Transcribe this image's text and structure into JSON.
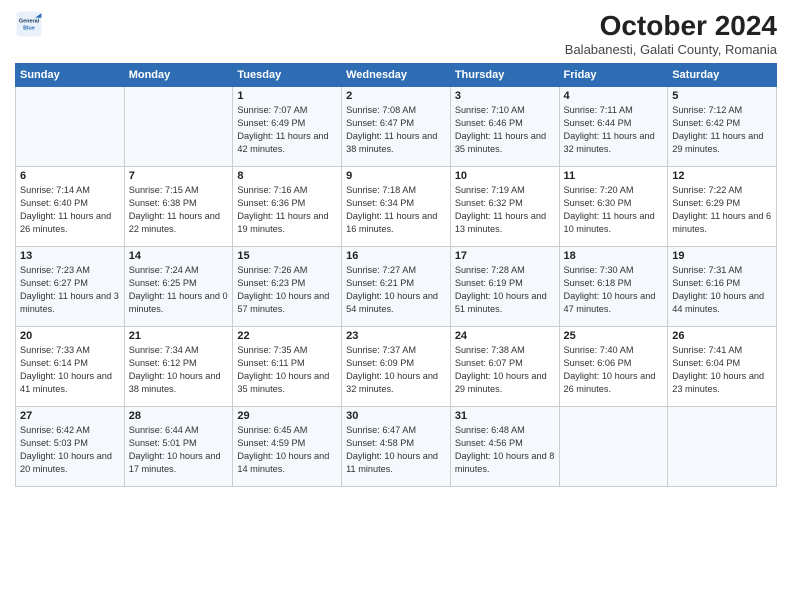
{
  "header": {
    "logo_line1": "General",
    "logo_line2": "Blue",
    "month_title": "October 2024",
    "subtitle": "Balabanesti, Galati County, Romania"
  },
  "days_of_week": [
    "Sunday",
    "Monday",
    "Tuesday",
    "Wednesday",
    "Thursday",
    "Friday",
    "Saturday"
  ],
  "weeks": [
    [
      {
        "day": "",
        "info": ""
      },
      {
        "day": "",
        "info": ""
      },
      {
        "day": "1",
        "info": "Sunrise: 7:07 AM\nSunset: 6:49 PM\nDaylight: 11 hours and 42 minutes."
      },
      {
        "day": "2",
        "info": "Sunrise: 7:08 AM\nSunset: 6:47 PM\nDaylight: 11 hours and 38 minutes."
      },
      {
        "day": "3",
        "info": "Sunrise: 7:10 AM\nSunset: 6:46 PM\nDaylight: 11 hours and 35 minutes."
      },
      {
        "day": "4",
        "info": "Sunrise: 7:11 AM\nSunset: 6:44 PM\nDaylight: 11 hours and 32 minutes."
      },
      {
        "day": "5",
        "info": "Sunrise: 7:12 AM\nSunset: 6:42 PM\nDaylight: 11 hours and 29 minutes."
      }
    ],
    [
      {
        "day": "6",
        "info": "Sunrise: 7:14 AM\nSunset: 6:40 PM\nDaylight: 11 hours and 26 minutes."
      },
      {
        "day": "7",
        "info": "Sunrise: 7:15 AM\nSunset: 6:38 PM\nDaylight: 11 hours and 22 minutes."
      },
      {
        "day": "8",
        "info": "Sunrise: 7:16 AM\nSunset: 6:36 PM\nDaylight: 11 hours and 19 minutes."
      },
      {
        "day": "9",
        "info": "Sunrise: 7:18 AM\nSunset: 6:34 PM\nDaylight: 11 hours and 16 minutes."
      },
      {
        "day": "10",
        "info": "Sunrise: 7:19 AM\nSunset: 6:32 PM\nDaylight: 11 hours and 13 minutes."
      },
      {
        "day": "11",
        "info": "Sunrise: 7:20 AM\nSunset: 6:30 PM\nDaylight: 11 hours and 10 minutes."
      },
      {
        "day": "12",
        "info": "Sunrise: 7:22 AM\nSunset: 6:29 PM\nDaylight: 11 hours and 6 minutes."
      }
    ],
    [
      {
        "day": "13",
        "info": "Sunrise: 7:23 AM\nSunset: 6:27 PM\nDaylight: 11 hours and 3 minutes."
      },
      {
        "day": "14",
        "info": "Sunrise: 7:24 AM\nSunset: 6:25 PM\nDaylight: 11 hours and 0 minutes."
      },
      {
        "day": "15",
        "info": "Sunrise: 7:26 AM\nSunset: 6:23 PM\nDaylight: 10 hours and 57 minutes."
      },
      {
        "day": "16",
        "info": "Sunrise: 7:27 AM\nSunset: 6:21 PM\nDaylight: 10 hours and 54 minutes."
      },
      {
        "day": "17",
        "info": "Sunrise: 7:28 AM\nSunset: 6:19 PM\nDaylight: 10 hours and 51 minutes."
      },
      {
        "day": "18",
        "info": "Sunrise: 7:30 AM\nSunset: 6:18 PM\nDaylight: 10 hours and 47 minutes."
      },
      {
        "day": "19",
        "info": "Sunrise: 7:31 AM\nSunset: 6:16 PM\nDaylight: 10 hours and 44 minutes."
      }
    ],
    [
      {
        "day": "20",
        "info": "Sunrise: 7:33 AM\nSunset: 6:14 PM\nDaylight: 10 hours and 41 minutes."
      },
      {
        "day": "21",
        "info": "Sunrise: 7:34 AM\nSunset: 6:12 PM\nDaylight: 10 hours and 38 minutes."
      },
      {
        "day": "22",
        "info": "Sunrise: 7:35 AM\nSunset: 6:11 PM\nDaylight: 10 hours and 35 minutes."
      },
      {
        "day": "23",
        "info": "Sunrise: 7:37 AM\nSunset: 6:09 PM\nDaylight: 10 hours and 32 minutes."
      },
      {
        "day": "24",
        "info": "Sunrise: 7:38 AM\nSunset: 6:07 PM\nDaylight: 10 hours and 29 minutes."
      },
      {
        "day": "25",
        "info": "Sunrise: 7:40 AM\nSunset: 6:06 PM\nDaylight: 10 hours and 26 minutes."
      },
      {
        "day": "26",
        "info": "Sunrise: 7:41 AM\nSunset: 6:04 PM\nDaylight: 10 hours and 23 minutes."
      }
    ],
    [
      {
        "day": "27",
        "info": "Sunrise: 6:42 AM\nSunset: 5:03 PM\nDaylight: 10 hours and 20 minutes."
      },
      {
        "day": "28",
        "info": "Sunrise: 6:44 AM\nSunset: 5:01 PM\nDaylight: 10 hours and 17 minutes."
      },
      {
        "day": "29",
        "info": "Sunrise: 6:45 AM\nSunset: 4:59 PM\nDaylight: 10 hours and 14 minutes."
      },
      {
        "day": "30",
        "info": "Sunrise: 6:47 AM\nSunset: 4:58 PM\nDaylight: 10 hours and 11 minutes."
      },
      {
        "day": "31",
        "info": "Sunrise: 6:48 AM\nSunset: 4:56 PM\nDaylight: 10 hours and 8 minutes."
      },
      {
        "day": "",
        "info": ""
      },
      {
        "day": "",
        "info": ""
      }
    ]
  ]
}
